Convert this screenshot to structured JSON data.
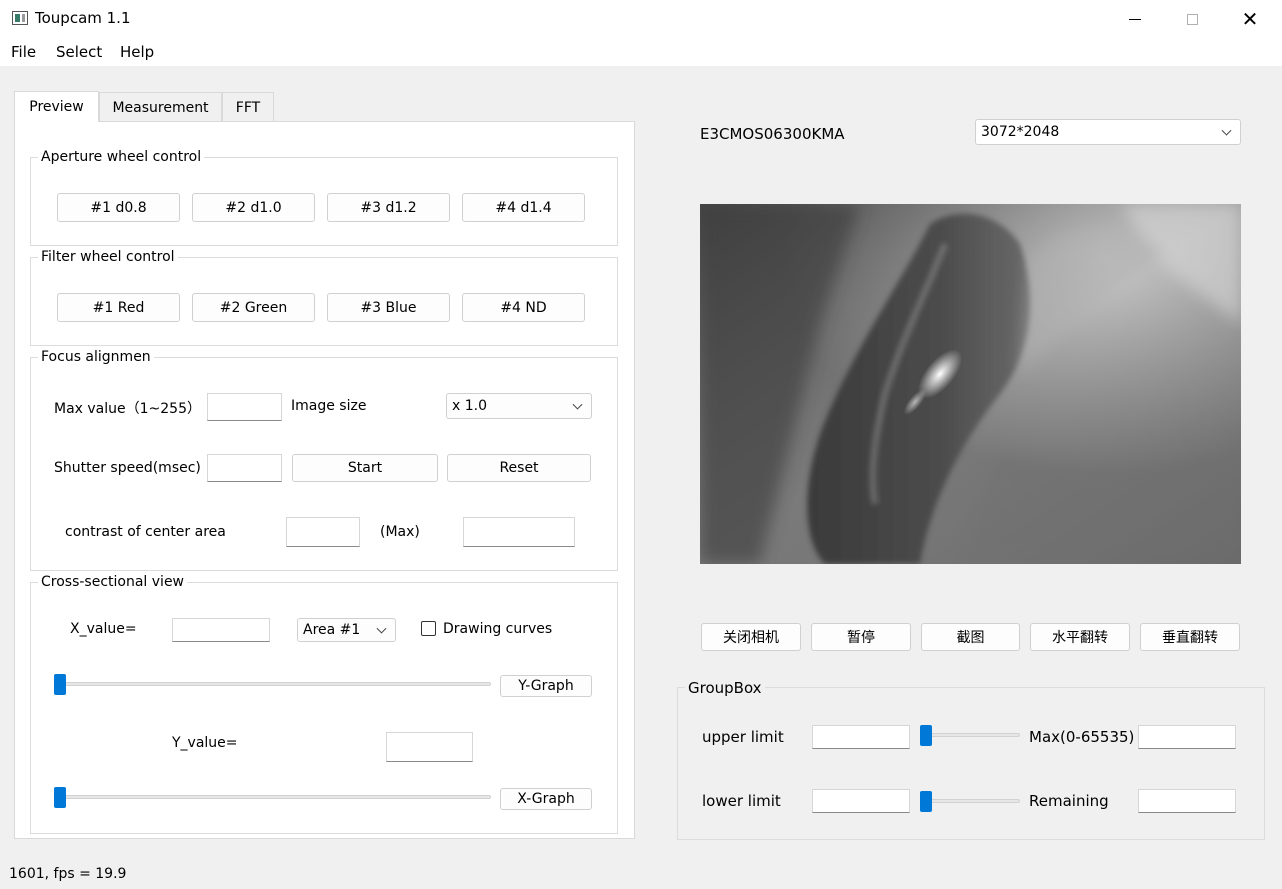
{
  "window": {
    "title": "Toupcam 1.1",
    "controls": {
      "minimize": "minimize-icon",
      "maximize": "maximize-icon",
      "close": "✕"
    }
  },
  "menu": [
    "File",
    "Select",
    "Help"
  ],
  "tabs": [
    "Preview",
    "Measurement",
    "FFT"
  ],
  "aperture": {
    "title": "Aperture wheel control",
    "buttons": [
      "#1 d0.8",
      "#2 d1.0",
      "#3 d1.2",
      "#4 d1.4"
    ]
  },
  "filter": {
    "title": "Filter wheel control",
    "buttons": [
      "#1 Red",
      "#2 Green",
      "#3 Blue",
      "#4 ND"
    ]
  },
  "focus": {
    "title": "Focus alignmen",
    "max_value_label": "Max value（1~255）",
    "max_value": "",
    "image_size_label": "Image size",
    "image_size": "x 1.0",
    "shutter_label": "Shutter speed(msec)",
    "shutter_value": "",
    "start": "Start",
    "reset": "Reset",
    "contrast_label": "contrast of center area",
    "contrast_value": "",
    "max_label": "(Max)",
    "max_contrast_value": ""
  },
  "cross": {
    "title": "Cross-sectional view",
    "x_label": "X_value=",
    "x_value": "",
    "area": "Area #1",
    "drawing_curves": "Drawing curves",
    "drawing_curves_checked": false,
    "y_graph": "Y-Graph",
    "y_label": "Y_value=",
    "y_value": "",
    "x_graph": "X-Graph",
    "slider1_level": 0,
    "slider2_level": 0
  },
  "camera": {
    "model": "E3CMOS06300KMA",
    "resolution": "3072*2048",
    "buttons": [
      "关闭相机",
      "暂停",
      "截图",
      "水平翻转",
      "垂直翻转"
    ]
  },
  "limits": {
    "title": "GroupBox",
    "upper_label": "upper limit",
    "upper_value": "",
    "max_label": "Max(0-65535)",
    "max_value": "",
    "lower_label": "lower limit",
    "lower_value": "",
    "remaining_label": "Remaining",
    "remaining_value": "",
    "upper_slider_level": 0,
    "lower_slider_level": 0
  },
  "status": "1601, fps = 19.9",
  "colors": {
    "accent": "#0078d7",
    "tab_active": "#ffffff",
    "background": "#f0f0f0"
  }
}
